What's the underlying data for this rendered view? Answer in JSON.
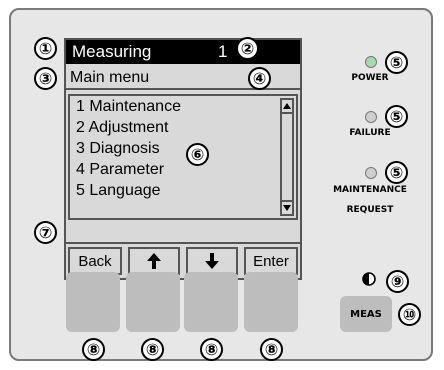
{
  "display": {
    "title": "Measuring",
    "title_number": "1",
    "menu_header": "Main menu",
    "menu_items": [
      "1 Maintenance",
      "2 Adjustment",
      "3 Diagnosis",
      "4 Parameter",
      "5 Language"
    ],
    "status_text": "",
    "softkeys": {
      "back": "Back",
      "up_icon": "arrow-up-icon",
      "down_icon": "arrow-down-icon",
      "enter": "Enter"
    }
  },
  "leds": {
    "power": {
      "label": "POWER",
      "color": "#a8d8b0"
    },
    "failure": {
      "label": "FAILURE",
      "color": "#cfcfcf"
    },
    "maintenance": {
      "label_line1": "MAINTENANCE",
      "label_line2": "REQUEST",
      "color": "#cfcfcf"
    }
  },
  "meas_button": {
    "label": "MEAS"
  },
  "contrast_icon": "contrast-icon",
  "callouts": {
    "c1": "①",
    "c2": "②",
    "c3": "③",
    "c4": "④",
    "c5": "⑤",
    "c6": "⑥",
    "c7": "⑦",
    "c8": "⑧",
    "c9": "⑨",
    "c10": "⑩"
  }
}
